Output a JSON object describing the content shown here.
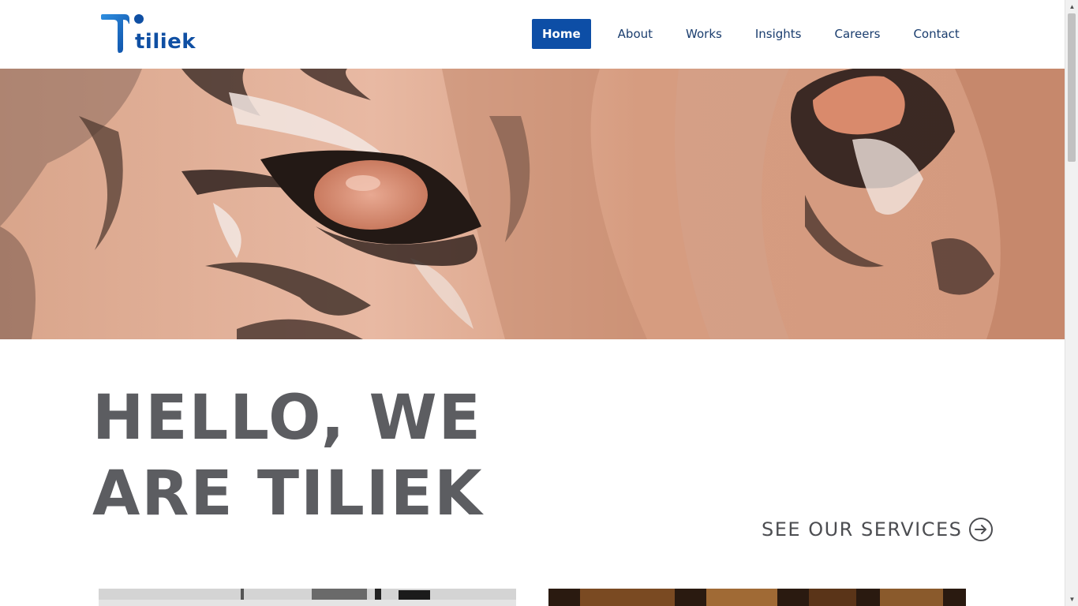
{
  "brand": {
    "name": "tiliek",
    "accent_color": "#0d4ea6"
  },
  "nav": {
    "items": [
      {
        "label": "Home",
        "active": true
      },
      {
        "label": "About",
        "active": false
      },
      {
        "label": "Works",
        "active": false
      },
      {
        "label": "Insights",
        "active": false
      },
      {
        "label": "Careers",
        "active": false
      },
      {
        "label": "Contact",
        "active": false
      }
    ]
  },
  "hero": {
    "image": "tiger-eye-painting"
  },
  "intro": {
    "headline_line1": "HELLO, WE",
    "headline_line2": "ARE TILIEK",
    "cta_label": "SEE OUR SERVICES",
    "cta_icon": "circle-arrow-right-icon"
  },
  "cards": [
    {
      "image": "black-and-white-photo"
    },
    {
      "image": "warm-toned-photo"
    }
  ]
}
